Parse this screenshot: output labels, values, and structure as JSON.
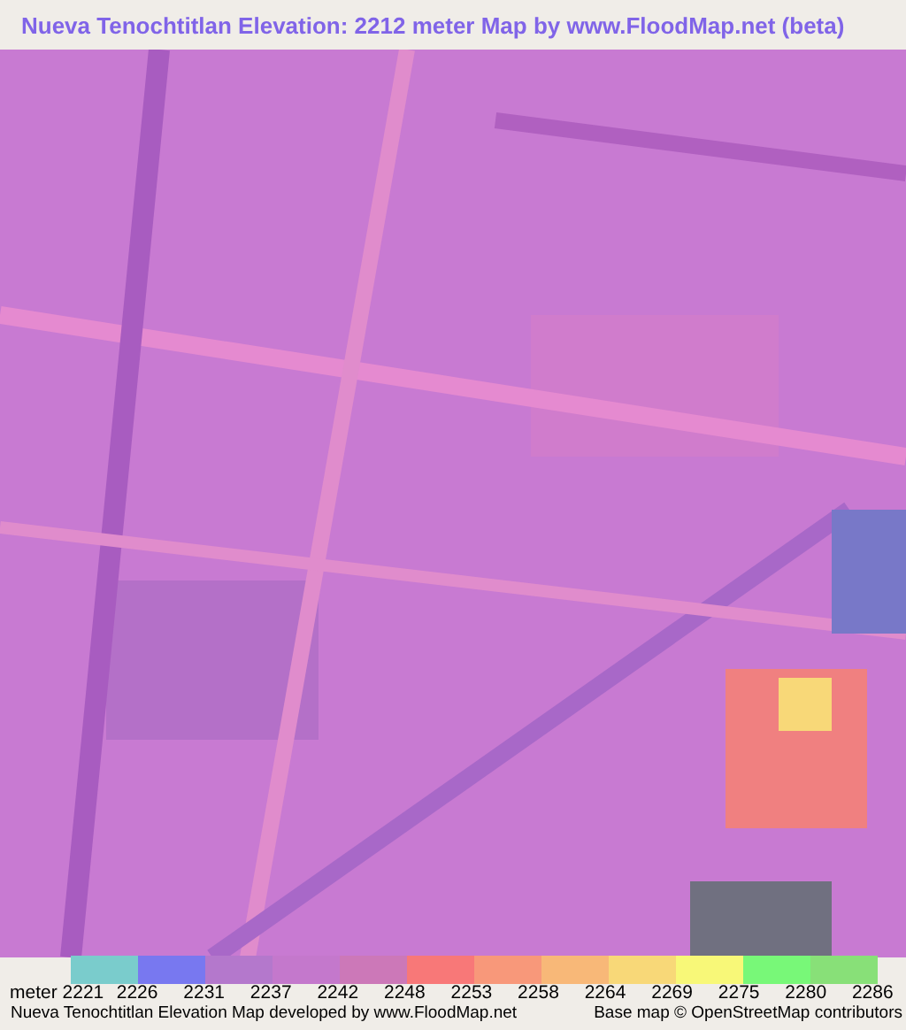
{
  "title": "Nueva Tenochtitlan Elevation: 2212 meter Map by www.FloodMap.net (beta)",
  "legend": {
    "swatches": [
      {
        "color": "#7acccc"
      },
      {
        "color": "#7878f0"
      },
      {
        "color": "#b478cc"
      },
      {
        "color": "#c478cc"
      },
      {
        "color": "#cc78b8"
      },
      {
        "color": "#f87878"
      },
      {
        "color": "#f8987a"
      },
      {
        "color": "#f8b878"
      },
      {
        "color": "#f8d878"
      },
      {
        "color": "#f8f878"
      },
      {
        "color": "#78f878"
      },
      {
        "color": "#88e078"
      }
    ],
    "labels": [
      "meter 2221",
      "2226",
      "2231",
      "2237",
      "2242",
      "2248",
      "2253",
      "2258",
      "2264",
      "2269",
      "2275",
      "2280",
      "2286"
    ]
  },
  "footer": {
    "credit": "Nueva Tenochtitlan Elevation Map developed by www.FloodMap.net",
    "attribution": "Base map © OpenStreetMap contributors"
  }
}
